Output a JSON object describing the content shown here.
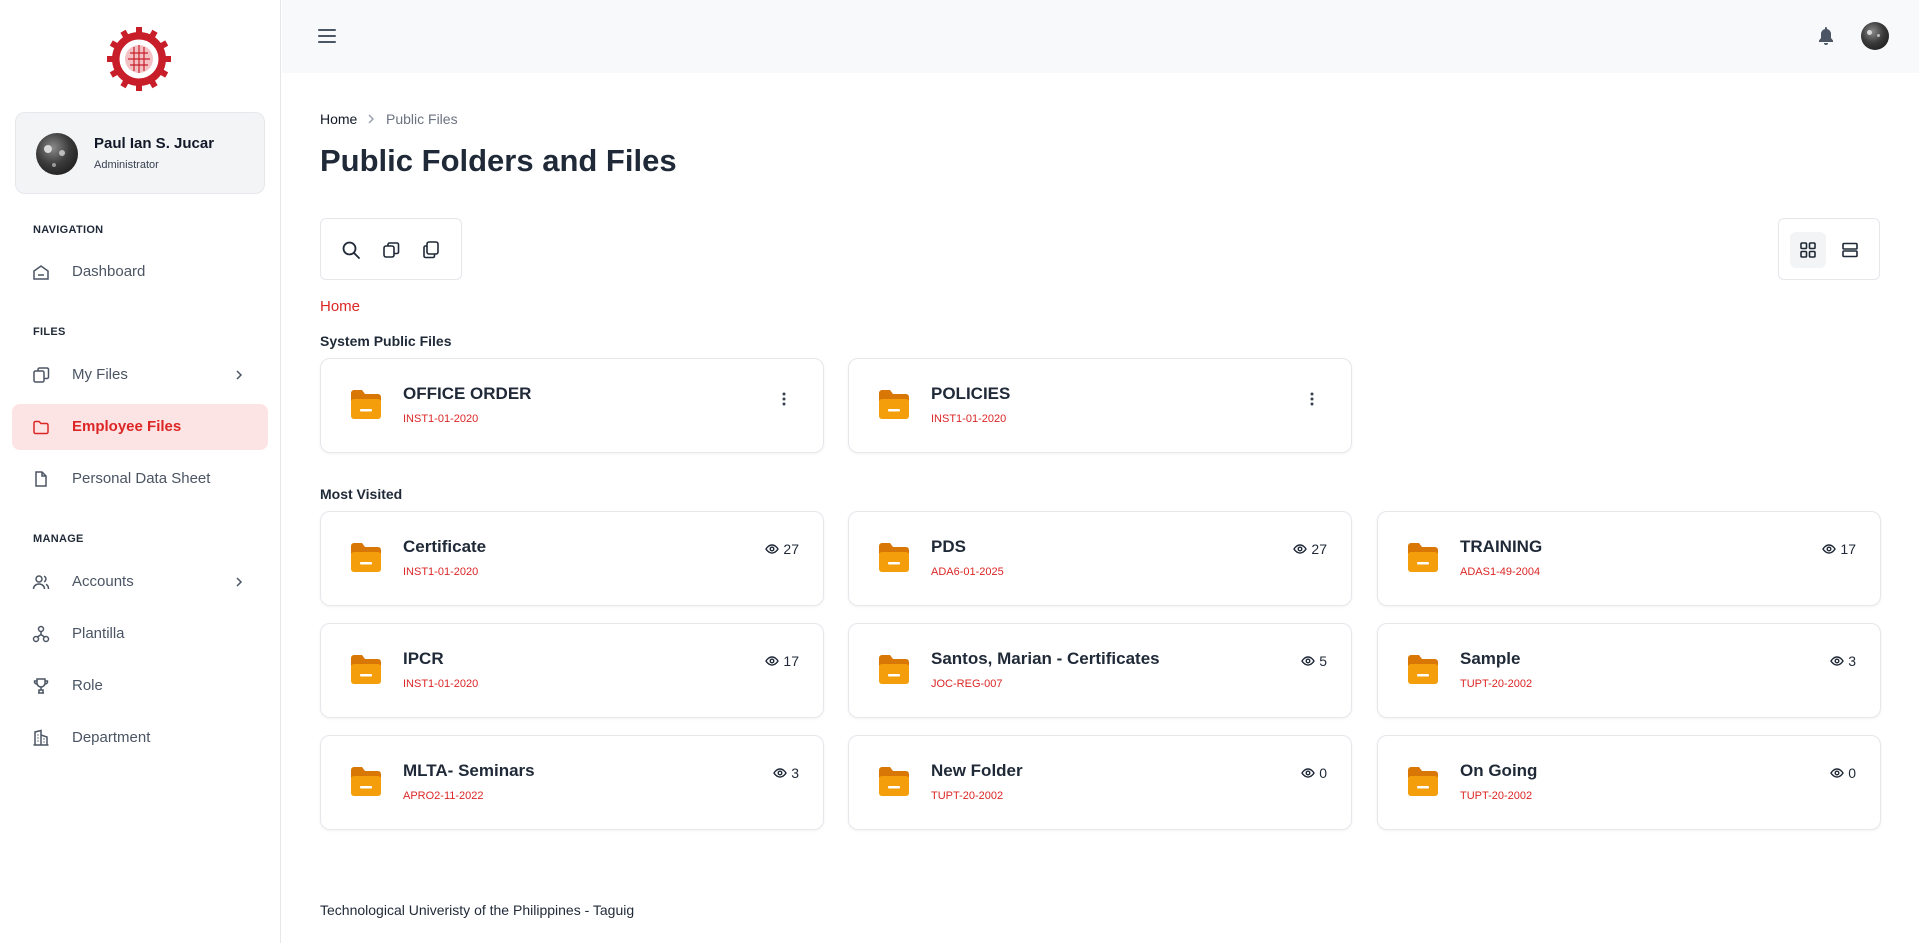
{
  "sidebar": {
    "user": {
      "name": "Paul Ian S. Jucar",
      "role": "Administrator"
    },
    "sections": [
      {
        "heading": "NAVIGATION",
        "items": [
          {
            "label": "Dashboard",
            "icon": "home-icon"
          }
        ]
      },
      {
        "heading": "FILES",
        "items": [
          {
            "label": "My Files",
            "icon": "files-icon",
            "has_submenu": true
          },
          {
            "label": "Employee Files",
            "icon": "folder-icon",
            "active": true
          },
          {
            "label": "Personal Data Sheet",
            "icon": "document-icon"
          }
        ]
      },
      {
        "heading": "MANAGE",
        "items": [
          {
            "label": "Accounts",
            "icon": "users-icon",
            "has_submenu": true
          },
          {
            "label": "Plantilla",
            "icon": "org-chart-icon"
          },
          {
            "label": "Role",
            "icon": "trophy-icon"
          },
          {
            "label": "Department",
            "icon": "building-icon"
          }
        ]
      }
    ]
  },
  "breadcrumb": {
    "home": "Home",
    "current": "Public Files"
  },
  "page_title": "Public Folders and Files",
  "folder_nav": {
    "current": "Home"
  },
  "system_public": {
    "title": "System Public Files",
    "folders": [
      {
        "name": "OFFICE ORDER",
        "code": "INST1-01-2020"
      },
      {
        "name": "POLICIES",
        "code": "INST1-01-2020"
      }
    ]
  },
  "most_visited": {
    "title": "Most Visited",
    "folders": [
      {
        "name": "Certificate",
        "code": "INST1-01-2020",
        "views": "27"
      },
      {
        "name": "PDS",
        "code": "ADA6-01-2025",
        "views": "27"
      },
      {
        "name": "TRAINING",
        "code": "ADAS1-49-2004",
        "views": "17"
      },
      {
        "name": "IPCR",
        "code": "INST1-01-2020",
        "views": "17"
      },
      {
        "name": "Santos, Marian - Certificates",
        "code": "JOC-REG-007",
        "views": "5"
      },
      {
        "name": "Sample",
        "code": "TUPT-20-2002",
        "views": "3"
      },
      {
        "name": "MLTA- Seminars",
        "code": "APRO2-11-2022",
        "views": "3"
      },
      {
        "name": "New Folder",
        "code": "TUPT-20-2002",
        "views": "0"
      },
      {
        "name": "On Going",
        "code": "TUPT-20-2002",
        "views": "0"
      }
    ]
  },
  "footer": "Technological Univeristy of the Philippines - Taguig",
  "colors": {
    "accent": "#dc2626",
    "folder": "#f59e0b",
    "active_bg": "#fde4e4"
  }
}
